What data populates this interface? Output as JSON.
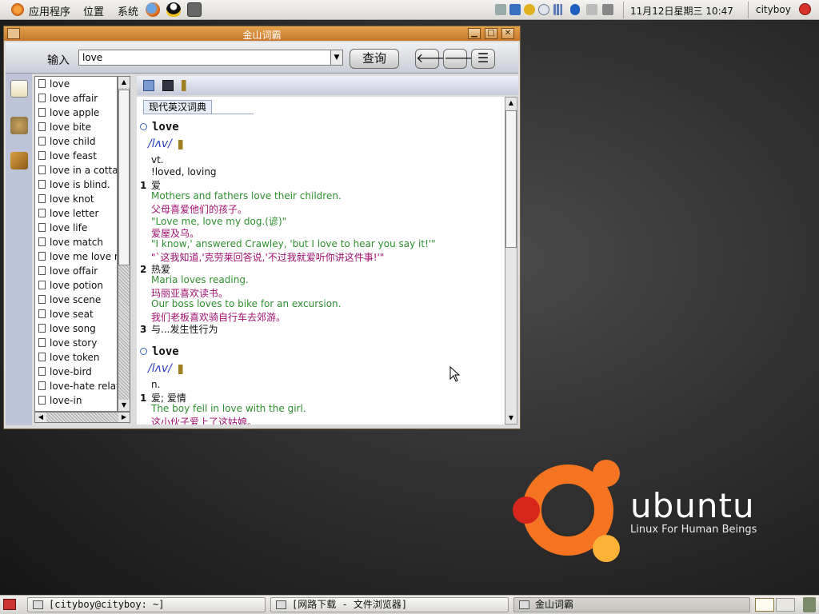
{
  "top_panel": {
    "menus": [
      "应用程序",
      "位置",
      "系统"
    ],
    "clock": "11月12日星期三 10:47",
    "user": "cityboy"
  },
  "window": {
    "title": "金山词霸",
    "controls": {
      "minimize": "▁",
      "maximize": "□",
      "close": "✕"
    }
  },
  "toolbar": {
    "input_label": "输入",
    "input_value": "love",
    "dropdown": "▼",
    "query_button": "查询",
    "back": "🡐",
    "forward": "🡒",
    "menu": "☰"
  },
  "wordlist": {
    "items": [
      "love",
      "love affair",
      "love apple",
      "love bite",
      "love child",
      "love feast",
      "love in a cottage",
      "love is blind.",
      "love knot",
      "love letter",
      "love life",
      "love match",
      "love me love my dog",
      "love offair",
      "love potion",
      "love scene",
      "love seat",
      "love song",
      "love story",
      "love token",
      "love-bird",
      "love-hate relationship",
      "love-in"
    ]
  },
  "content": {
    "dict_tab": "现代英汉词典",
    "entries": [
      {
        "headword": "love",
        "pron": "/lʌv/",
        "pos": "vt.",
        "forms": "!loved, loving",
        "senses": [
          {
            "num": "1",
            "def": "爱",
            "examples": [
              {
                "en": "Mothers and fathers love their children.",
                "zh": "父母喜爱他们的孩子。"
              },
              {
                "en": "\"Love me, love my dog.(谚)\"",
                "zh": "爱屋及乌。"
              },
              {
                "en": "\"I know,' answered Crawley, 'but I love to hear you say it!'\"",
                "zh": "\"`这我知道,'克劳莱回答说,'不过我就爱听你讲这件事!'\""
              }
            ]
          },
          {
            "num": "2",
            "def": "热爱",
            "examples": [
              {
                "en": "Maria loves reading.",
                "zh": "玛丽亚喜欢读书。"
              },
              {
                "en": "Our boss loves to bike for an excursion.",
                "zh": "我们老板喜欢骑自行车去郊游。"
              }
            ]
          },
          {
            "num": "3",
            "def": "与...发生性行为",
            "examples": []
          }
        ]
      },
      {
        "headword": "love",
        "pron": "/lʌv/",
        "pos": "n.",
        "senses": [
          {
            "num": "1",
            "def": "爱; 爱情",
            "examples": [
              {
                "en": "The boy fell in love with the girl.",
                "zh": "这小伙子爱上了这姑娘。"
              }
            ]
          }
        ]
      }
    ]
  },
  "desktop": {
    "logo_word": "ubuntu",
    "logo_tagline": "Linux For Human Beings",
    "colors": {
      "orange": "#f47421",
      "red": "#d9261c",
      "yellow": "#fbb036"
    }
  },
  "taskbar": {
    "tasks": [
      {
        "label": "[cityboy@cityboy: ~]",
        "active": false
      },
      {
        "label": "[网路下载 - 文件浏览器]",
        "active": false
      },
      {
        "label": "金山词霸",
        "active": true
      }
    ]
  }
}
